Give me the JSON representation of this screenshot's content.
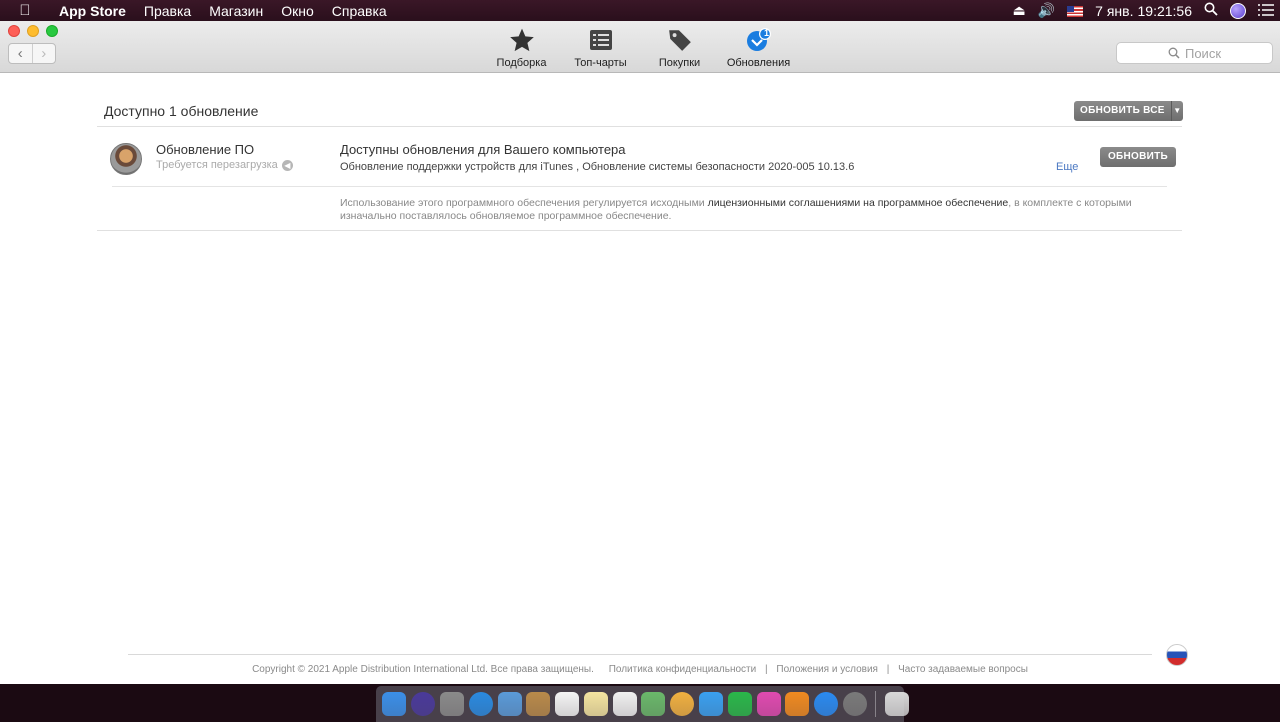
{
  "menubar": {
    "apple_icon": "apple-logo-icon",
    "app_name": "App Store",
    "items": [
      "Правка",
      "Магазин",
      "Окно",
      "Справка"
    ],
    "date": "7 янв.",
    "time": "19:21:56"
  },
  "toolbar": {
    "tabs": [
      {
        "label": "Подборка",
        "icon": "star-icon"
      },
      {
        "label": "Топ-чарты",
        "icon": "list-icon"
      },
      {
        "label": "Покупки",
        "icon": "tag-icon"
      },
      {
        "label": "Обновления",
        "icon": "updates-icon",
        "badge": "1"
      }
    ],
    "search_placeholder": "Поиск"
  },
  "updates": {
    "heading": "Доступно 1 обновление",
    "update_all_label": "ОБНОВИТЬ ВСЕ",
    "item": {
      "name": "Обновление ПО",
      "subtitle": "Требуется перезагрузка",
      "title": "Доступны обновления для Вашего компьютера",
      "description": "Обновление поддержки устройств для iTunes , Обновление системы безопасности 2020-005 10.13.6",
      "more_label": "Еще",
      "update_label": "ОБНОВИТЬ"
    },
    "license_prefix": "Использование этого программного обеспечения регулируется исходными ",
    "license_link": "лицензионными соглашениями на программное обеспечение",
    "license_suffix": ", в комплекте с которыми изначально поставлялось обновляемое программное обеспечение."
  },
  "footer": {
    "copyright": "Copyright © 2021 Apple Distribution International Ltd. Все права защищены.",
    "links": [
      "Политика конфиденциальности",
      "Положения и условия",
      "Часто задаваемые вопросы"
    ],
    "separator": "|"
  },
  "dock": {
    "items": [
      {
        "name": "finder",
        "color": "#3b8fe8"
      },
      {
        "name": "siri",
        "color": "#4a3a9a"
      },
      {
        "name": "launchpad",
        "color": "#8a8a8a"
      },
      {
        "name": "safari",
        "color": "#2a8ae0"
      },
      {
        "name": "mail",
        "color": "#5a9ad8"
      },
      {
        "name": "contacts",
        "color": "#b98a4a"
      },
      {
        "name": "calendar",
        "color": "#f4f4f4"
      },
      {
        "name": "notes",
        "color": "#f4e4a0"
      },
      {
        "name": "reminders",
        "color": "#f0f0f0"
      },
      {
        "name": "maps",
        "color": "#6ab86a"
      },
      {
        "name": "photos",
        "color": "#f0b040"
      },
      {
        "name": "messages",
        "color": "#3aa0f0"
      },
      {
        "name": "facetime",
        "color": "#2ab84a"
      },
      {
        "name": "itunes",
        "color": "#e04ab0"
      },
      {
        "name": "books",
        "color": "#f08a20"
      },
      {
        "name": "app-store",
        "color": "#2a8af0"
      },
      {
        "name": "system-preferences",
        "color": "#7a7a7a"
      },
      {
        "name": "trash",
        "color": "#d8d8d8"
      }
    ]
  }
}
